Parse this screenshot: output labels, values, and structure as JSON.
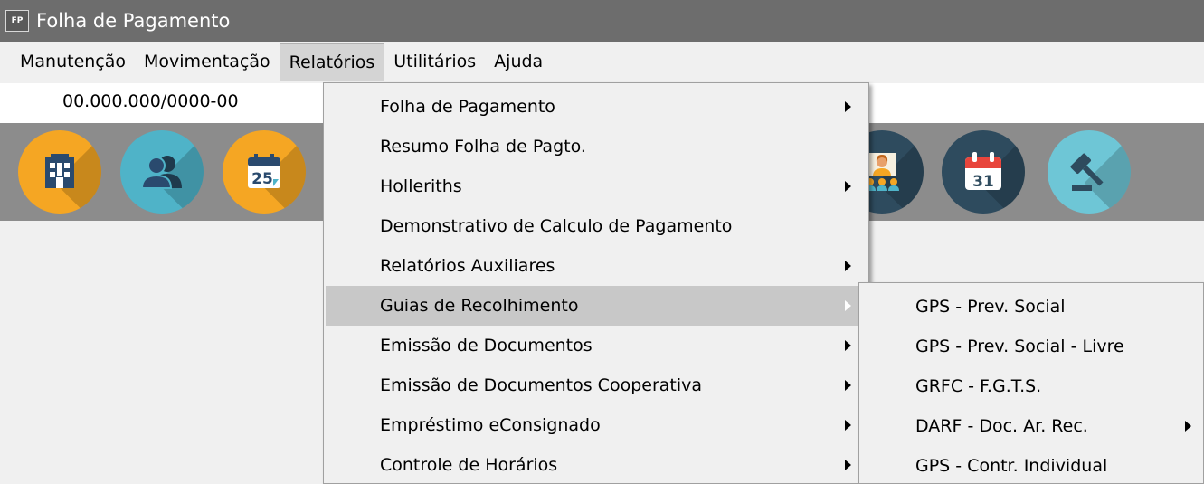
{
  "window": {
    "title": "Folha de Pagamento",
    "icon_text": "FP"
  },
  "menubar": {
    "items": [
      {
        "label": "Manutenção"
      },
      {
        "label": "Movimentação"
      },
      {
        "label": "Relatórios"
      },
      {
        "label": "Utilitários"
      },
      {
        "label": "Ajuda"
      }
    ]
  },
  "company": {
    "cnpj": "00.000.000/0000-00"
  },
  "toolbar": {
    "buttons": [
      {
        "icon": "building-icon",
        "color": "#f5a623"
      },
      {
        "icon": "users-icon",
        "color": "#4fb3c8"
      },
      {
        "icon": "calendar-25-icon",
        "color": "#f5a623",
        "text": "25"
      },
      {
        "icon": "employees-icon",
        "color": "#2e4b5e"
      },
      {
        "icon": "calendar-31-icon",
        "color": "#2e4b5e",
        "text": "31"
      },
      {
        "icon": "gavel-icon",
        "color": "#6ec6d6"
      }
    ]
  },
  "relatorios_menu": {
    "items": [
      {
        "label": "Folha de Pagamento",
        "submenu": true
      },
      {
        "label": "Resumo Folha de Pagto.",
        "submenu": false
      },
      {
        "label": "Holleriths",
        "submenu": true
      },
      {
        "label": "Demonstrativo de Calculo de Pagamento",
        "submenu": false
      },
      {
        "label": "Relatórios Auxiliares",
        "submenu": true
      },
      {
        "label": "Guias de Recolhimento",
        "submenu": true,
        "highlighted": true
      },
      {
        "label": "Emissão de Documentos",
        "submenu": true
      },
      {
        "label": "Emissão de Documentos Cooperativa",
        "submenu": true
      },
      {
        "label": "Empréstimo eConsignado",
        "submenu": true
      },
      {
        "label": "Controle de Horários",
        "submenu": true
      }
    ]
  },
  "guias_submenu": {
    "items": [
      {
        "label": "GPS - Prev. Social",
        "submenu": false
      },
      {
        "label": "GPS - Prev. Social - Livre",
        "submenu": false
      },
      {
        "label": "GRFC - F.G.T.S.",
        "submenu": false
      },
      {
        "label": "DARF - Doc. Ar. Rec.",
        "submenu": true
      },
      {
        "label": "GPS - Contr. Individual",
        "submenu": false
      }
    ]
  }
}
